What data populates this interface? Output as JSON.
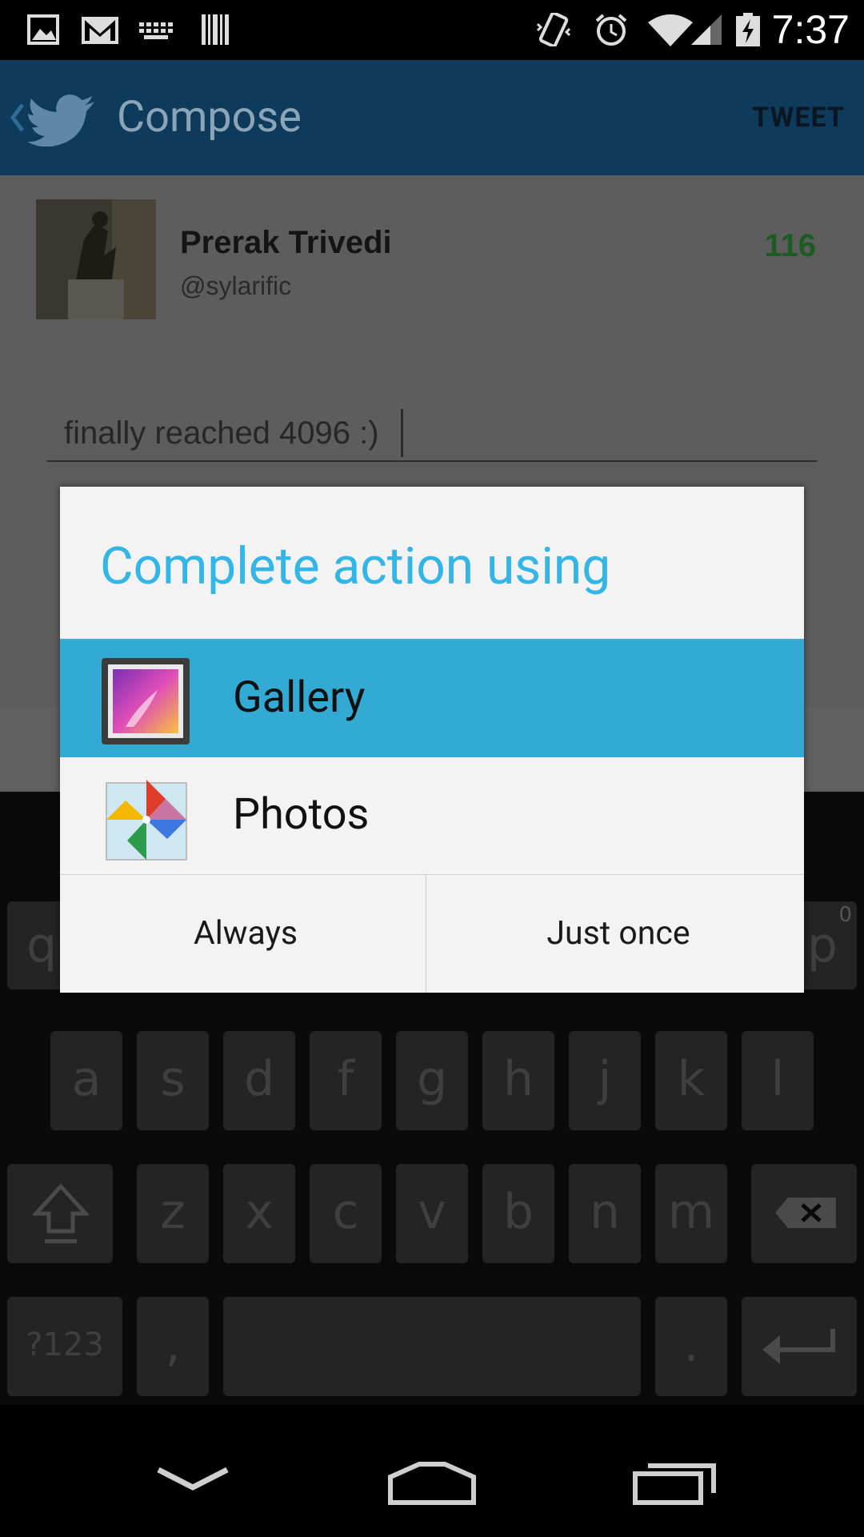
{
  "status_bar": {
    "time": "7:37",
    "icons": [
      "image-notification-icon",
      "gmail-icon",
      "keyboard-icon",
      "barcode-icon",
      "vibrate-icon",
      "alarm-icon",
      "wifi-icon",
      "signal-icon",
      "battery-charging-icon"
    ]
  },
  "action_bar": {
    "title": "Compose",
    "action": "TWEET",
    "back_icon": "chevron-left-icon",
    "app_icon": "twitter-bird-icon"
  },
  "compose": {
    "user_name": "Prerak Trivedi",
    "user_handle": "@sylarific",
    "char_count": "116",
    "tweet_text": "finally reached 4096 :)"
  },
  "dialog": {
    "title": "Complete action using",
    "apps": [
      {
        "label": "Gallery",
        "icon": "gallery-icon",
        "selected": true
      },
      {
        "label": "Photos",
        "icon": "photos-pinwheel-icon",
        "selected": false
      }
    ],
    "buttons": {
      "always": "Always",
      "just_once": "Just once"
    }
  },
  "keyboard": {
    "row1_visible": [
      "q",
      "p"
    ],
    "row1_hint": "0",
    "row2": [
      "a",
      "s",
      "d",
      "f",
      "g",
      "h",
      "j",
      "k",
      "l"
    ],
    "row3": [
      "z",
      "x",
      "c",
      "v",
      "b",
      "n",
      "m"
    ],
    "symbols": "?123",
    "comma": ",",
    "period": "."
  },
  "colors": {
    "accent": "#33b5e5",
    "selected_row": "#33aad4",
    "action_bar": "#0e3b5c",
    "char_count": "#1c5b22"
  }
}
